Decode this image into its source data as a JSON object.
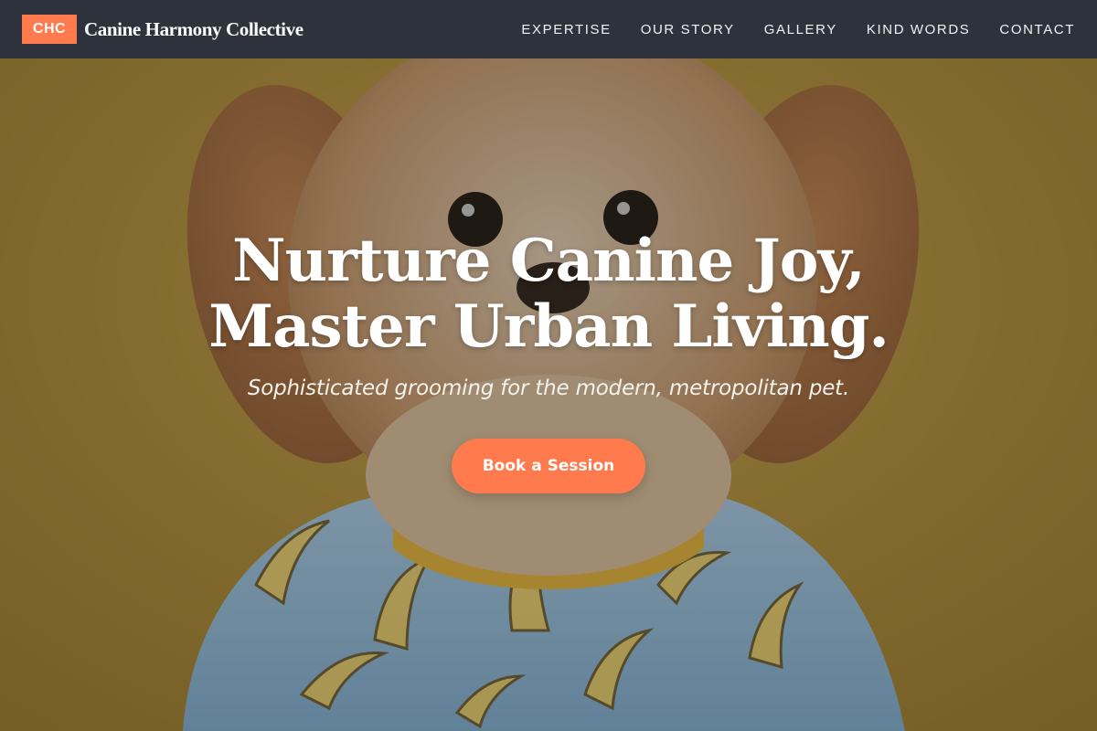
{
  "brand": {
    "badge": "CHC",
    "name": "Canine Harmony Collective"
  },
  "nav": {
    "items": [
      {
        "label": "EXPERTISE"
      },
      {
        "label": "OUR STORY"
      },
      {
        "label": "GALLERY"
      },
      {
        "label": "KIND WORDS"
      },
      {
        "label": "CONTACT"
      }
    ]
  },
  "hero": {
    "title_line1": "Nurture Canine Joy,",
    "title_line2": "Master Urban Living.",
    "subtitle": "Sophisticated grooming for the modern, metropolitan pet.",
    "cta_label": "Book a Session",
    "background_image": "dog-in-banana-print-shirt-photo"
  },
  "colors": {
    "accent": "#ff7a4d",
    "navbar": "#2d323c",
    "hero_background": "#b0902e",
    "text_light": "#ffffff"
  }
}
